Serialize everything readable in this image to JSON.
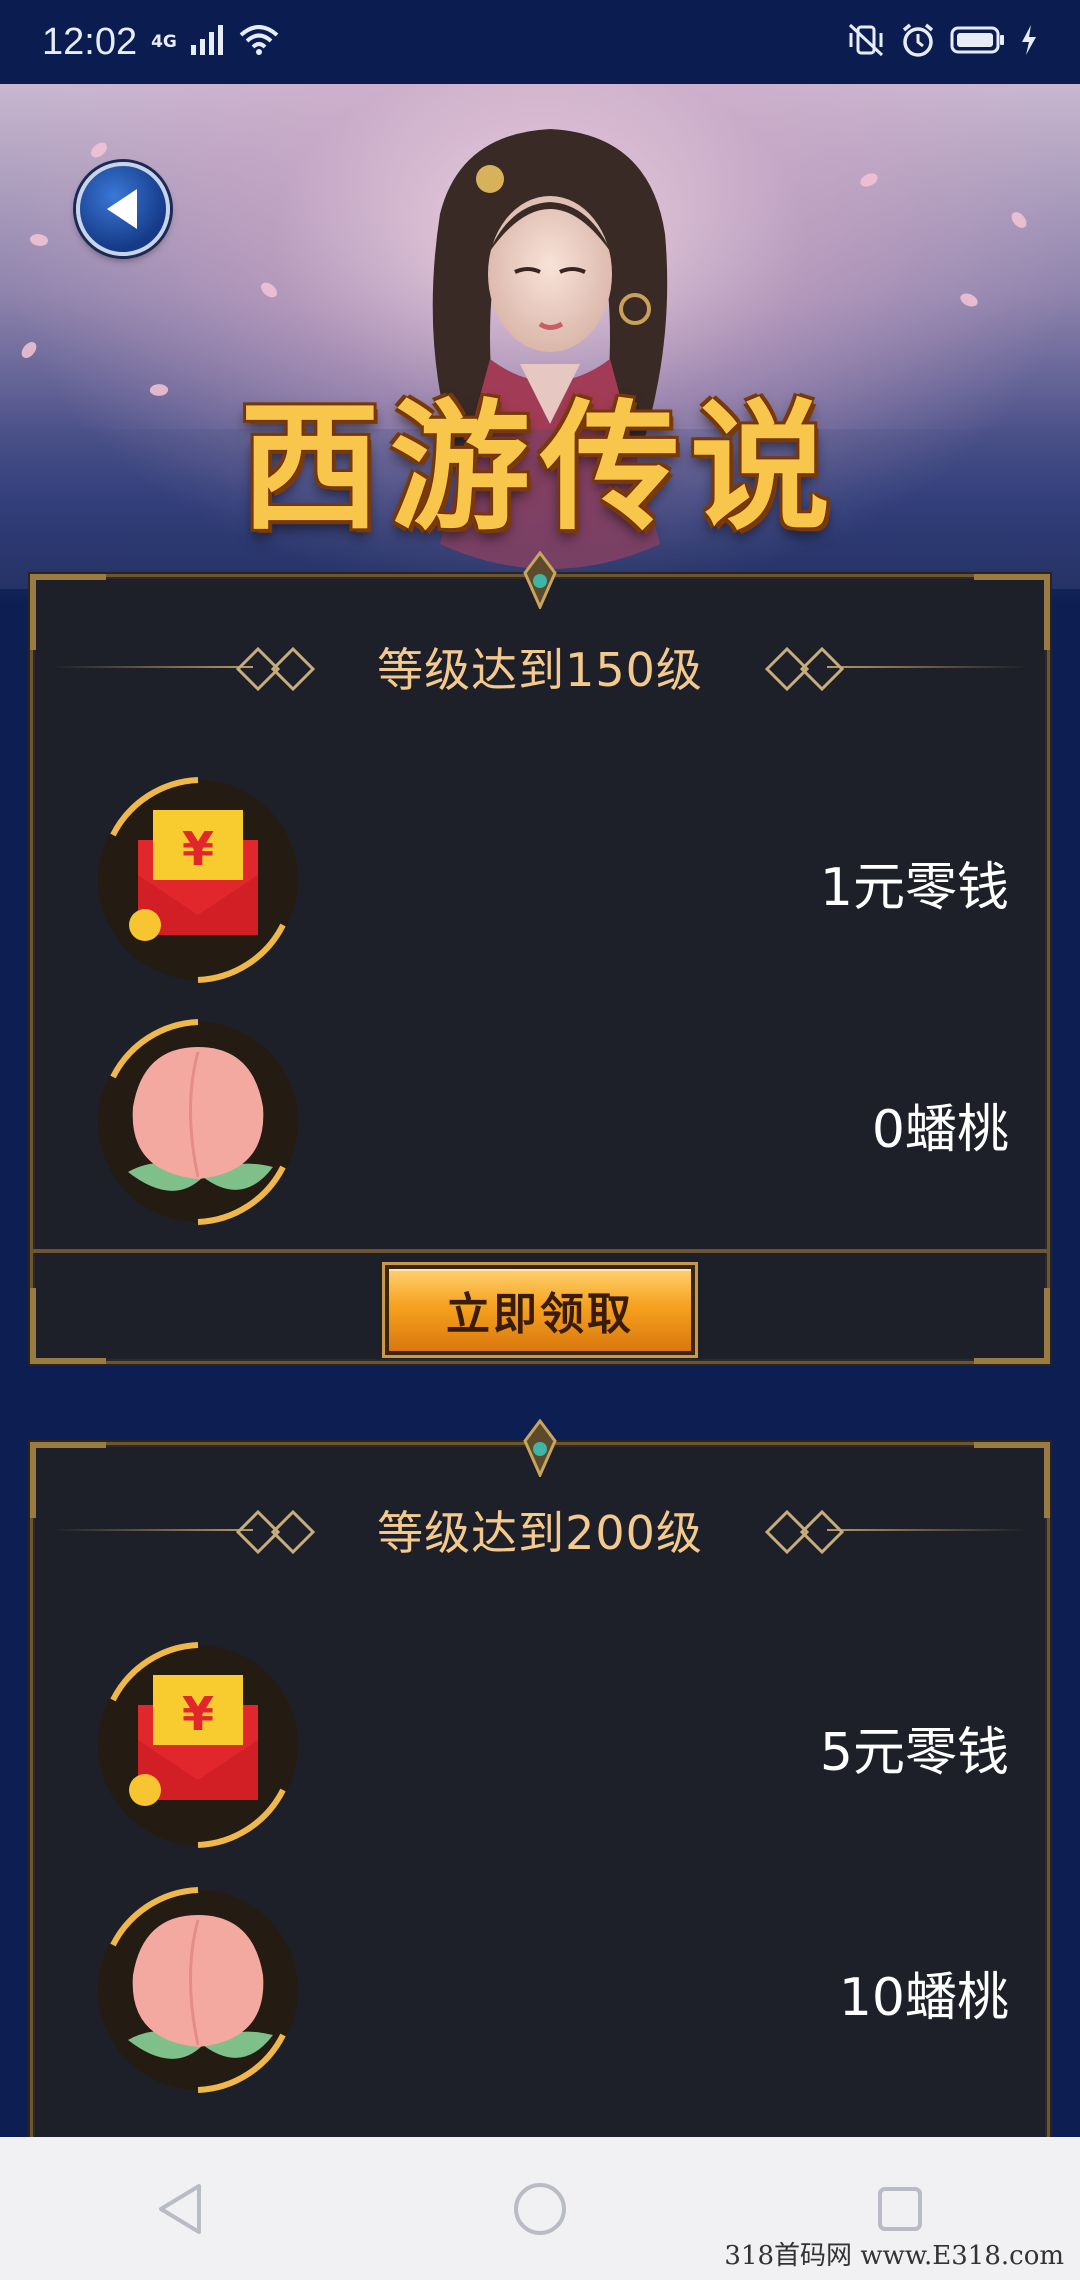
{
  "status_bar": {
    "time": "12:02",
    "network": "4G",
    "icons": [
      "signal-icon",
      "wifi-icon",
      "mute-vibrate-icon",
      "alarm-icon",
      "battery-icon",
      "charging-icon"
    ]
  },
  "header": {
    "game_title": "西游传说",
    "back_icon": "back-arrow-icon"
  },
  "panels": [
    {
      "heading": "等级达到150级",
      "rewards": [
        {
          "icon": "red-envelope-icon",
          "label": "1元零钱"
        },
        {
          "icon": "peach-icon",
          "label": "0蟠桃"
        }
      ],
      "claim_label": "立即领取"
    },
    {
      "heading": "等级达到200级",
      "rewards": [
        {
          "icon": "red-envelope-icon",
          "label": "5元零钱"
        },
        {
          "icon": "peach-icon",
          "label": "10蟠桃"
        }
      ]
    }
  ],
  "nav_bar": {
    "buttons": [
      "back-triangle-icon",
      "home-circle-icon",
      "recents-square-icon"
    ]
  },
  "watermark": "318首码网 www.E318.com",
  "colors": {
    "background": "#0d1f52",
    "panel": "#1e2029",
    "heading": "#f4c98d",
    "button": "#f6a21f",
    "title": "#f7c64a"
  }
}
